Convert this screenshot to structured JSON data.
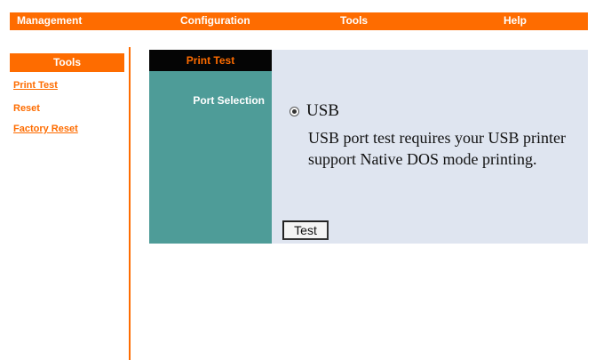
{
  "topnav": {
    "items": [
      "Management",
      "Configuration",
      "Tools",
      "Help"
    ]
  },
  "sidebar": {
    "header": "Tools",
    "links": [
      "Print Test",
      "Reset",
      "Factory Reset"
    ]
  },
  "main": {
    "tab_title": "Print Test",
    "port_selection_label": "Port Selection",
    "radio_label": "USB",
    "description": "USB port test requires your USB printer support Native DOS mode printing.",
    "test_button_label": "Test"
  },
  "colors": {
    "accent": "#fe6c00",
    "panel_teal": "#4e9c98",
    "content_bg": "#dfe5f0",
    "tab_bg": "#050505"
  }
}
